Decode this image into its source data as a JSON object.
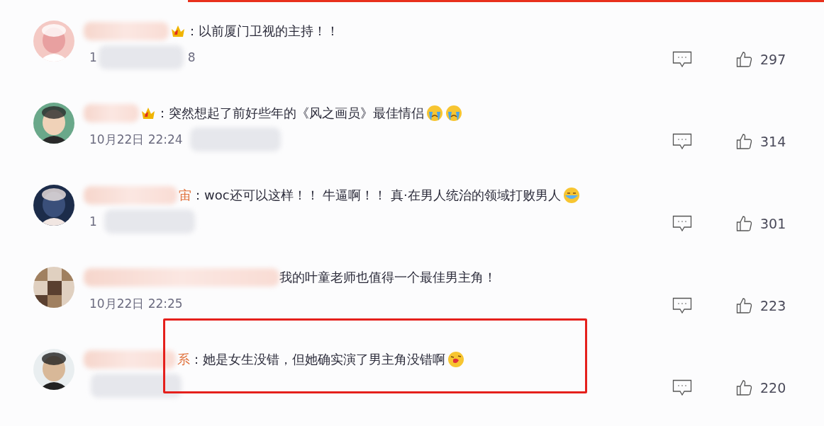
{
  "comments": [
    {
      "badge": true,
      "text": "：以前厦门卫视的主持！！",
      "time_parts": [
        "1",
        "8"
      ],
      "time_redacted": true,
      "likes": "297",
      "highlighted": false
    },
    {
      "badge": true,
      "text": "：突然想起了前好些年的《风之画员》最佳情侣",
      "emojis": [
        {
          "kind": "crying"
        },
        {
          "kind": "crying"
        }
      ],
      "time_parts": [
        "10月22日 22:24"
      ],
      "time_redacted": true,
      "likes": "314",
      "highlighted": false
    },
    {
      "name_fragment": "宙",
      "badge": false,
      "text": "：woc还可以这样！！ 牛逼啊！！ 真·在男人统治的领域打败男人",
      "emojis": [
        {
          "kind": "tears"
        }
      ],
      "time_parts": [
        "1"
      ],
      "time_redacted": true,
      "likes": "301",
      "highlighted": false
    },
    {
      "badge": false,
      "text": "我的叶童老师也值得一个最佳男主角！",
      "time_parts": [
        "10月22日 22:25"
      ],
      "time_redacted": false,
      "likes": "223",
      "highlighted": false
    },
    {
      "name_fragment": "系",
      "badge": false,
      "text": "：她是女生没错，但她确实演了男主角没错啊",
      "emojis": [
        {
          "kind": "kiss"
        }
      ],
      "time_redacted": true,
      "likes": "220",
      "highlighted": true
    }
  ]
}
